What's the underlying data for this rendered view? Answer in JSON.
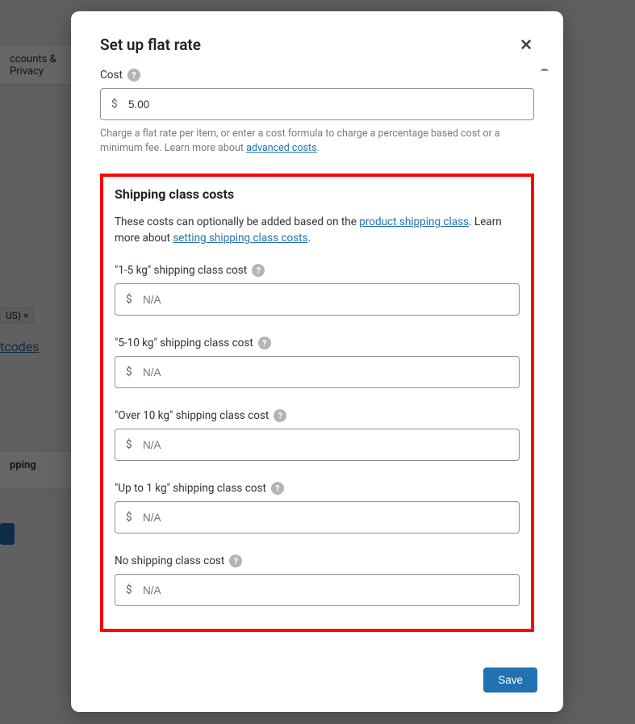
{
  "background": {
    "sidebar_item_1": "ccounts & Privacy",
    "tag": "US)  ×",
    "link": "tcodes",
    "sidebar_item_2": "pping"
  },
  "modal": {
    "title": "Set up flat rate",
    "close_glyph": "✕",
    "help_glyph": "?",
    "currency": "$",
    "cost": {
      "label": "Cost",
      "value": "5.00",
      "help_pre": "Charge a flat rate per item, or enter a cost formula to charge a percentage based cost or a minimum fee. Learn more about ",
      "help_link": "advanced costs",
      "help_post": "."
    },
    "shipping_classes": {
      "title": "Shipping class costs",
      "desc_pre": "These costs can optionally be added based on the ",
      "desc_link1": "product shipping class",
      "desc_mid": ". Learn more about ",
      "desc_link2": "setting shipping class costs",
      "desc_post": ".",
      "placeholder": "N/A",
      "items": [
        {
          "label": "\"1-5 kg\" shipping class cost",
          "value": ""
        },
        {
          "label": "\"5-10 kg\" shipping class cost",
          "value": ""
        },
        {
          "label": "\"Over 10 kg\" shipping class cost",
          "value": ""
        },
        {
          "label": "\"Up to 1 kg\" shipping class cost",
          "value": ""
        },
        {
          "label": "No shipping class cost",
          "value": ""
        }
      ]
    },
    "save_label": "Save"
  }
}
